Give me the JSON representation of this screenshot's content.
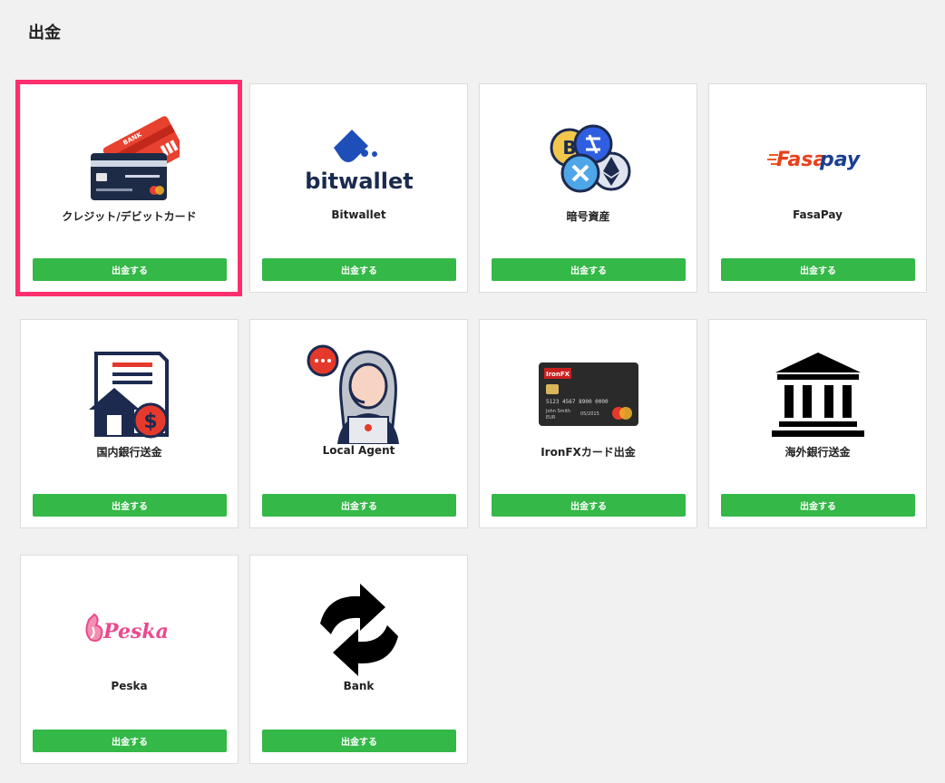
{
  "page": {
    "title": "出金"
  },
  "colors": {
    "button": "#34b847",
    "highlight": "#ff2f6d",
    "background": "#f1f1f1"
  },
  "methods": [
    {
      "name": "クレジット/デビットカード",
      "button": "出金する",
      "icon": "credit-card-icon",
      "card_text": "BANK"
    },
    {
      "name": "Bitwallet",
      "button": "出金する",
      "icon": "bitwallet-logo",
      "logo_text": "bitwallet"
    },
    {
      "name": "暗号資産",
      "button": "出金する",
      "icon": "crypto-coins-icon"
    },
    {
      "name": "FasaPay",
      "button": "出金する",
      "icon": "fasapay-logo",
      "logo_text_a": "Fasa",
      "logo_text_b": "pay"
    },
    {
      "name": "国内銀行送金",
      "button": "出金する",
      "icon": "domestic-bank-icon"
    },
    {
      "name": "Local Agent",
      "button": "出金する",
      "icon": "local-agent-icon"
    },
    {
      "name": "IronFXカード出金",
      "button": "出金する",
      "icon": "ironfx-card-icon",
      "card_brand": "IronFX",
      "card_number": "5123 4567 8900 0000",
      "card_holder": "John Smith",
      "card_currency": "EUR",
      "card_expiry": "05/2015"
    },
    {
      "name": "海外銀行送金",
      "button": "出金する",
      "icon": "bank-building-icon"
    },
    {
      "name": "Peska",
      "button": "出金する",
      "icon": "peska-logo",
      "logo_text": "Peska"
    },
    {
      "name": "Bank",
      "button": "出金する",
      "icon": "refresh-arrows-icon"
    }
  ]
}
